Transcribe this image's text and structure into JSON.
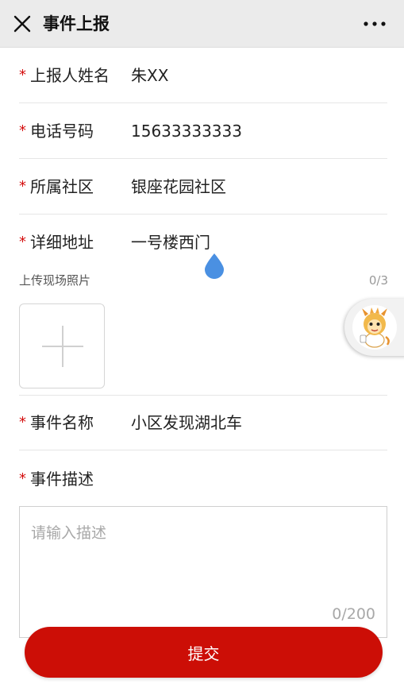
{
  "header": {
    "title": "事件上报",
    "close_icon": "close-icon",
    "more_icon": "more-icon"
  },
  "form": {
    "reporter": {
      "label": "上报人姓名",
      "value": "朱XX"
    },
    "phone": {
      "label": "电话号码",
      "value": "15633333333"
    },
    "community": {
      "label": "所属社区",
      "value": "银座花园社区"
    },
    "address": {
      "label": "详细地址",
      "value": "一号楼西门"
    },
    "photos": {
      "label": "上传现场照片",
      "count": "0/3"
    },
    "event_name": {
      "label": "事件名称",
      "value": "小区发现湖北车"
    },
    "description": {
      "label": "事件描述",
      "placeholder": "请输入描述",
      "count": "0/200"
    },
    "required_mark": "*"
  },
  "submit_label": "提交",
  "colors": {
    "accent": "#cc0e06",
    "required": "#d40d0d",
    "marker": "#4a90e2"
  }
}
